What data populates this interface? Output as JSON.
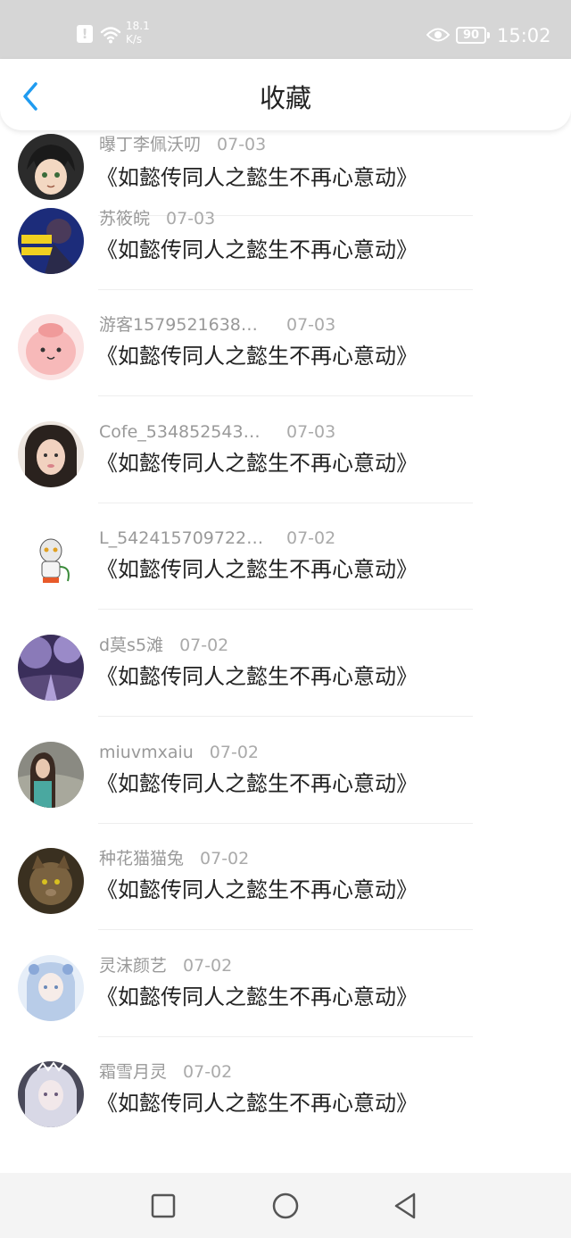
{
  "status_bar": {
    "speed_value": "18.1",
    "speed_unit": "K/s",
    "battery": "90",
    "time": "15:02"
  },
  "header": {
    "title": "收藏"
  },
  "colors": {
    "accent": "#1f9bf0",
    "text_primary": "#222222",
    "text_secondary": "#999999"
  },
  "items": [
    {
      "name": "曝丁李佩沃叨",
      "date": "07-03",
      "story": "《如懿传同人之懿生不再心意动》"
    },
    {
      "name": "苏筱皖",
      "date": "07-03",
      "story": "《如懿传同人之懿生不再心意动》"
    },
    {
      "name": "游客1579521638…",
      "date": "07-03",
      "story": "《如懿传同人之懿生不再心意动》"
    },
    {
      "name": "Cofe_534852543…",
      "date": "07-03",
      "story": "《如懿传同人之懿生不再心意动》"
    },
    {
      "name": "L_542415709722…",
      "date": "07-02",
      "story": "《如懿传同人之懿生不再心意动》"
    },
    {
      "name": "d莫s5滩",
      "date": "07-02",
      "story": "《如懿传同人之懿生不再心意动》"
    },
    {
      "name": "miuvmxaiu",
      "date": "07-02",
      "story": "《如懿传同人之懿生不再心意动》"
    },
    {
      "name": "种花猫猫兔",
      "date": "07-02",
      "story": "《如懿传同人之懿生不再心意动》"
    },
    {
      "name": "灵沫颜艺",
      "date": "07-02",
      "story": "《如懿传同人之懿生不再心意动》"
    },
    {
      "name": "霜雪月灵",
      "date": "07-02",
      "story": "《如懿传同人之懿生不再心意动》"
    }
  ],
  "nav": {
    "icons": [
      "square-icon",
      "circle-icon",
      "triangle-back-icon"
    ]
  }
}
